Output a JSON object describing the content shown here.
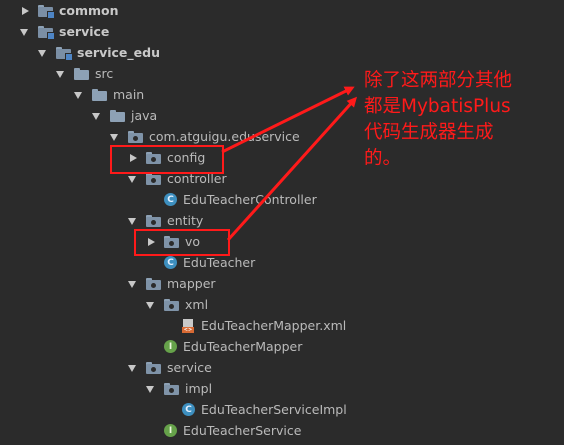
{
  "tree": {
    "common": "common",
    "service": "service",
    "service_edu": "service_edu",
    "src": "src",
    "main": "main",
    "java": "java",
    "package": "com.atguigu.eduservice",
    "config": "config",
    "controller": "controller",
    "edu_teacher_controller": "EduTeacherController",
    "entity": "entity",
    "vo": "vo",
    "edu_teacher": "EduTeacher",
    "mapper": "mapper",
    "xml": "xml",
    "edu_teacher_mapper_xml": "EduTeacherMapper.xml",
    "edu_teacher_mapper": "EduTeacherMapper",
    "service_pkg": "service",
    "impl": "impl",
    "edu_teacher_service_impl": "EduTeacherServiceImpl",
    "edu_teacher_service": "EduTeacherService"
  },
  "icons": {
    "class_letter": "C",
    "interface_letter": "I",
    "xml_tag": "<>"
  },
  "annotation": {
    "line1": "除了这两部分其他",
    "line2": "都是MybatisPlus",
    "line3": "代码生成器生成",
    "line4": "的。"
  },
  "colors": {
    "background": "#2b2b2b",
    "annotation": "#ff1a1a",
    "class_icon": "#3d8fbf",
    "interface_icon": "#66a24a"
  }
}
